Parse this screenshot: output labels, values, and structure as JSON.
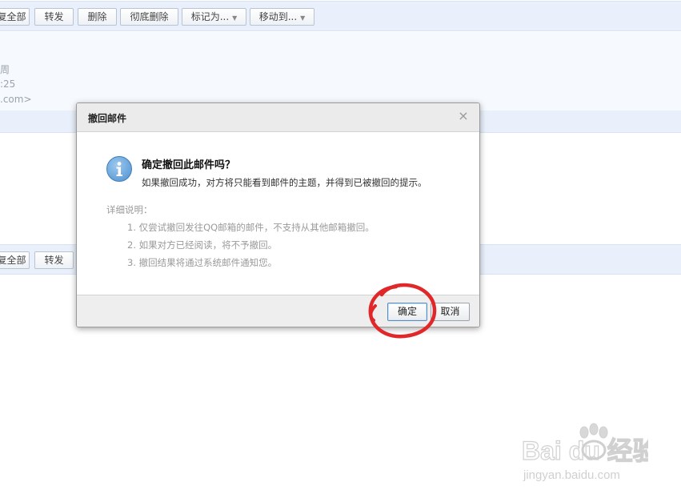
{
  "toolbar_top": {
    "buttons": [
      {
        "label": "复全部"
      },
      {
        "label": "转发"
      },
      {
        "label": "删除"
      },
      {
        "label": "彻底删除"
      },
      {
        "label": "标记为...",
        "dropdown": true
      },
      {
        "label": "移动到...",
        "dropdown": true
      }
    ]
  },
  "mail_header": {
    "line1": "周",
    "line2": ":25",
    "line3": ".com>"
  },
  "toolbar_bottom": {
    "buttons": [
      {
        "label": "复全部"
      },
      {
        "label": "转发"
      }
    ]
  },
  "dialog": {
    "title": "撤回邮件",
    "close_glyph": "×",
    "question": "确定撤回此邮件吗？",
    "subtitle": "如果撤回成功，对方将只能看到邮件的主题，并得到已被撤回的提示。",
    "detail_label": "详细说明：",
    "details": [
      "1. 仅尝试撤回发往QQ邮箱的邮件，不支持从其他邮箱撤回。",
      "2. 如果对方已经阅读，将不予撤回。",
      "3. 撤回结果将通过系统邮件通知您。"
    ],
    "confirm_label": "确定",
    "cancel_label": "取消"
  },
  "watermark": {
    "brand": "Bai du 经验",
    "url": "jingyan.baidu.com"
  },
  "colors": {
    "toolbar_bg": "#e9f0fb",
    "annotation": "#e0282a",
    "info_icon": "#4d8fd0"
  }
}
